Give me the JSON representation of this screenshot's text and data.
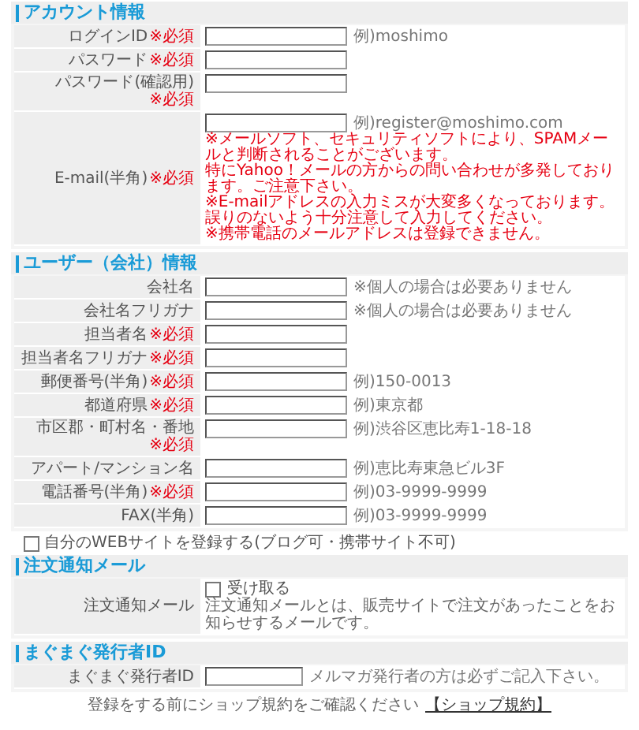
{
  "blocks": [
    {
      "kind": "section",
      "title": "アカウント情報",
      "rows": [
        {
          "kind": "input",
          "label": "ログインID",
          "required": "※必須",
          "hint": "例)moshimo"
        },
        {
          "kind": "input",
          "label": "パスワード",
          "required": "※必須"
        },
        {
          "kind": "input",
          "label": "パスワード(確認用)",
          "required": "※必須"
        },
        {
          "kind": "input",
          "label": "E-mail(半角)",
          "required": "※必須",
          "hint": "例)register@moshimo.com",
          "warnings": [
            "※メールソフト、セキュリティソフトにより、SPAMメールと判断されることがございます。",
            "特にYahoo！メールの方からの問い合わせが多発しております。ご注意下さい。",
            "※E-mailアドレスの入力ミスが大変多くなっております。",
            "誤りのないよう十分注意して入力してください。",
            "※携帯電話のメールアドレスは登録できません。"
          ]
        }
      ]
    },
    {
      "kind": "section",
      "title": "ユーザー（会社）情報",
      "rows": [
        {
          "kind": "input",
          "label": "会社名",
          "hint": "※個人の場合は必要ありません"
        },
        {
          "kind": "input",
          "label": "会社名フリガナ",
          "hint": "※個人の場合は必要ありません"
        },
        {
          "kind": "input",
          "label": "担当者名",
          "required": "※必須"
        },
        {
          "kind": "input",
          "label": "担当者名フリガナ",
          "required": "※必須"
        },
        {
          "kind": "input",
          "label": "郵便番号(半角)",
          "required": "※必須",
          "hint": "例)150-0013"
        },
        {
          "kind": "input",
          "label": "都道府県",
          "required": "※必須",
          "hint": "例)東京都"
        },
        {
          "kind": "input",
          "label": "市区郡・町村名・番地",
          "required": "※必須",
          "hint": "例)渋谷区恵比寿1-18-18"
        },
        {
          "kind": "input",
          "label": "アパート/マンション名",
          "hint": "例)恵比寿東急ビル3F"
        },
        {
          "kind": "input",
          "label": "電話番号(半角)",
          "required": "※必須",
          "hint": "例)03-9999-9999"
        },
        {
          "kind": "input",
          "label": "FAX(半角)",
          "hint": "例)03-9999-9999"
        }
      ]
    },
    {
      "kind": "checkbox",
      "label": "自分のWEBサイトを登録する(ブログ可・携帯サイト不可)",
      "checked": false
    },
    {
      "kind": "section",
      "title": "注文通知メール",
      "rows": [
        {
          "kind": "checkbox",
          "label": "注文通知メール",
          "option": "受け取る",
          "checked": false,
          "note": "注文通知メールとは、販売サイトで注文があったことをお知らせするメールです。"
        }
      ]
    },
    {
      "kind": "section",
      "title": "まぐまぐ発行者ID",
      "rows": [
        {
          "kind": "input",
          "label": "まぐまぐ発行者ID",
          "note": "メルマガ発行者の方は必ずご記入下さい。"
        }
      ]
    }
  ],
  "footer": {
    "text": "登録をする前にショップ規約をご確認ください",
    "link": "【ショップ規約】"
  }
}
